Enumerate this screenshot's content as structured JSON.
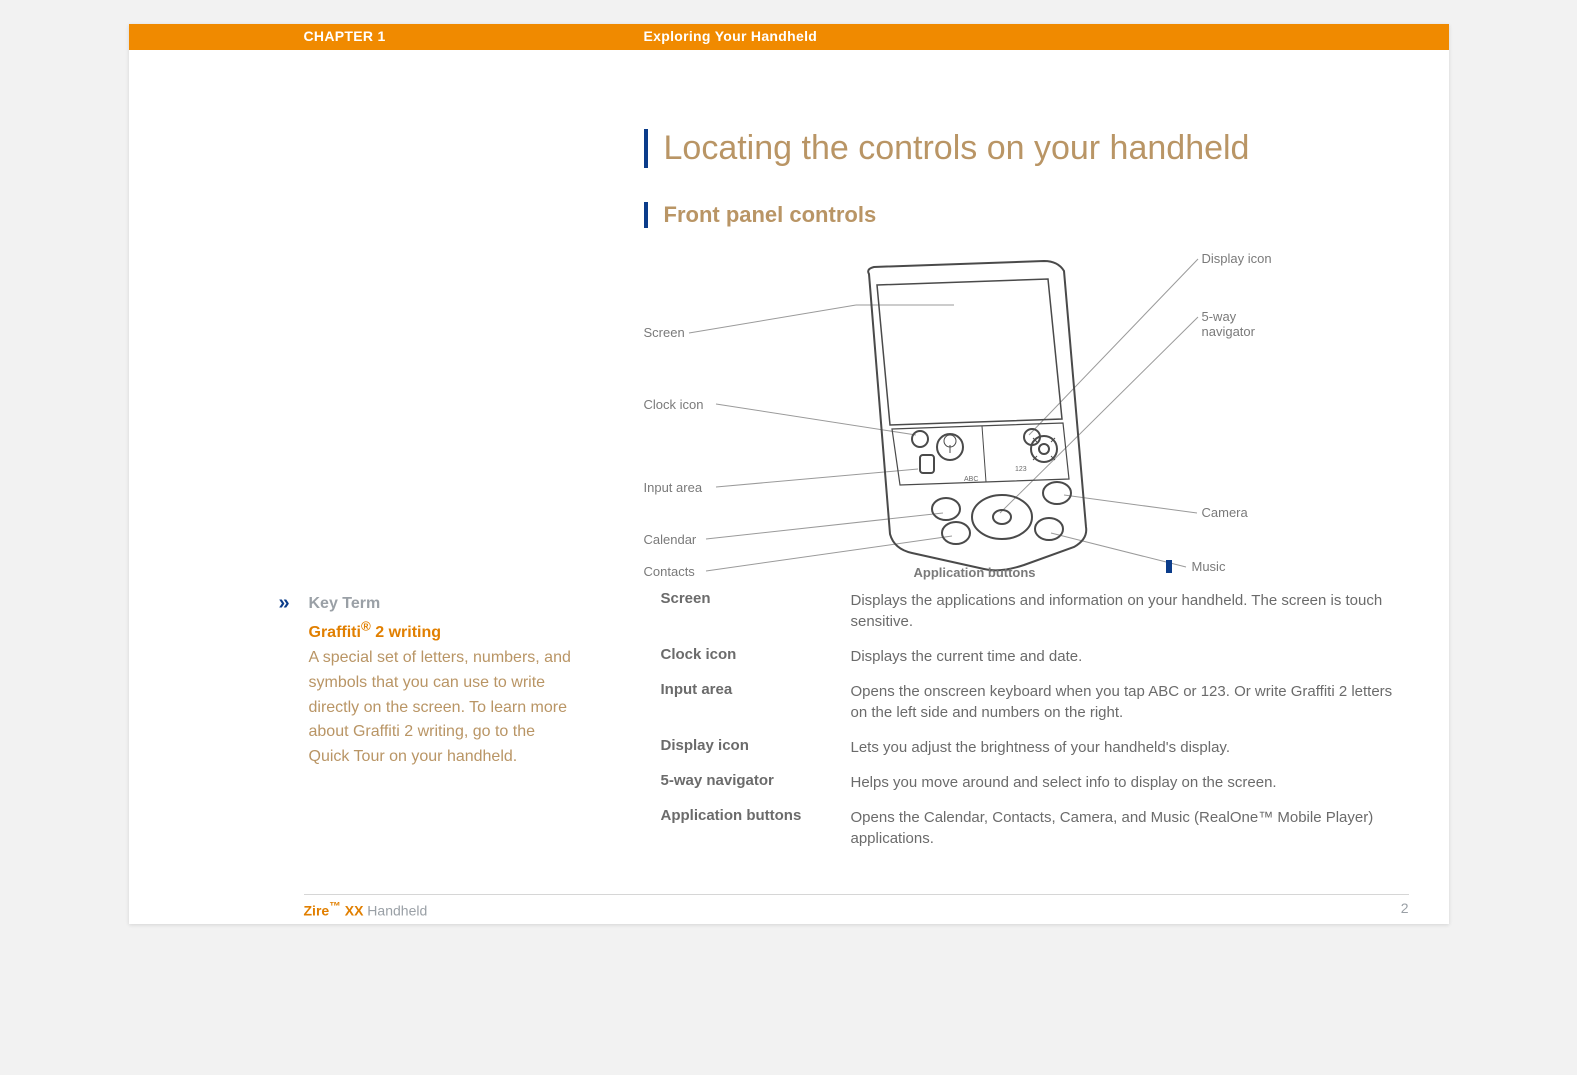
{
  "header": {
    "chapter": "CHAPTER 1",
    "title": "Exploring Your Handheld"
  },
  "headings": {
    "h1": "Locating the controls on your handheld",
    "h2": "Front panel controls"
  },
  "sidebar": {
    "chevron": "»",
    "key_term_label": "Key Term",
    "term_name_pre": "Graffiti",
    "term_name_sup": "®",
    "term_name_post": " 2 writing",
    "term_body": "A special set of letters, numbers, and symbols that you can use to write directly on the screen. To learn more about Graffiti 2 writing, go to the Quick Tour on your handheld."
  },
  "callouts": {
    "left": {
      "screen": "Screen",
      "clock_icon": "Clock icon",
      "input_area": "Input area",
      "calendar": "Calendar",
      "contacts": "Contacts"
    },
    "right": {
      "display_icon": "Display icon",
      "five_way": "5-way navigator",
      "camera": "Camera",
      "music": "Music"
    },
    "bottom": {
      "application_buttons": "Application buttons"
    },
    "input_tags": {
      "abc": "ABC",
      "num": "123"
    }
  },
  "definitions": [
    {
      "term": "Screen",
      "desc": "Displays the applications and information on your handheld. The screen is touch sensitive.",
      "bar": false
    },
    {
      "term": "Clock icon",
      "desc": "Displays the current time and date.",
      "bar": false
    },
    {
      "term": "Input area",
      "desc": "Opens the onscreen keyboard when you tap ABC or 123. Or write Graffiti 2 letters on the left side and numbers on the right.",
      "bar": true
    },
    {
      "term": "Display icon",
      "desc": "Lets you adjust the brightness of your handheld's display.",
      "bar": false
    },
    {
      "term": "5-way navigator",
      "desc": "Helps you move around and select info to display on the screen.",
      "bar": false
    },
    {
      "term": "Application buttons",
      "desc": "Opens the Calendar, Contacts, Camera, and Music (RealOne™ Mobile Player) applications.",
      "bar": true
    }
  ],
  "footer": {
    "brand_pre": "Zire",
    "brand_sup": "™",
    "brand_mid": " XX",
    "brand_post": " Handheld",
    "page_no": "2"
  }
}
